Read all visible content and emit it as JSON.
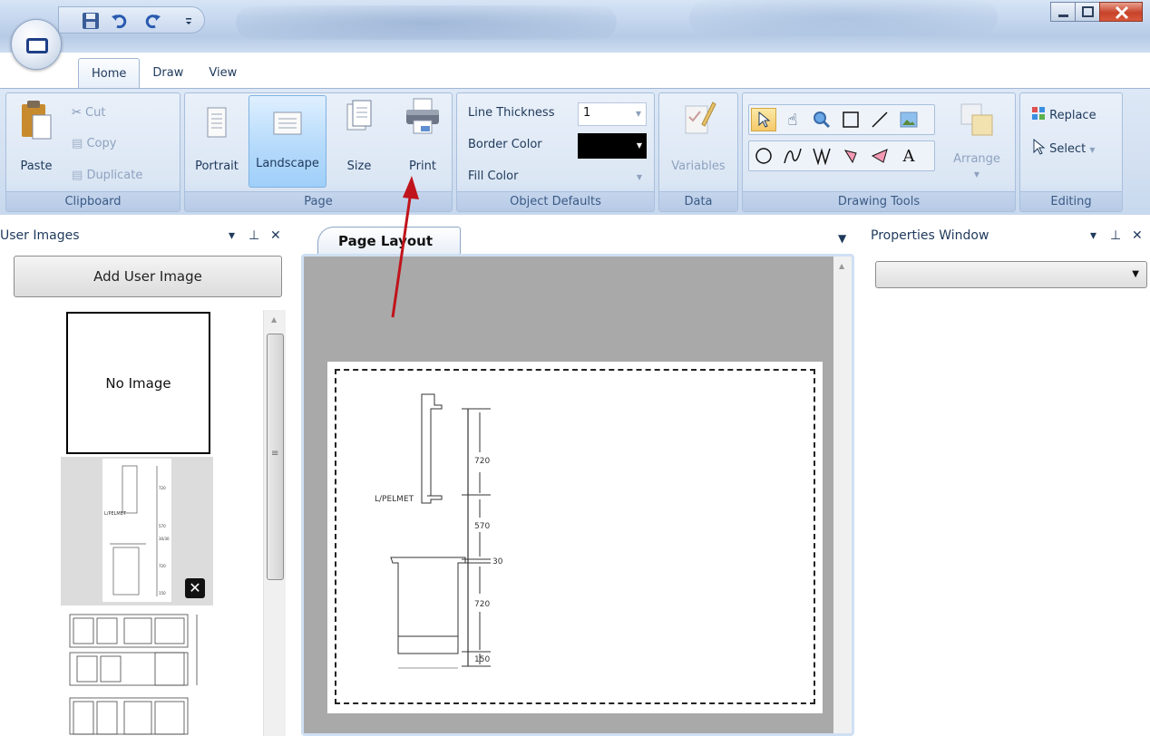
{
  "tabs": [
    {
      "label": "Home",
      "active": true
    },
    {
      "label": "Draw",
      "active": false
    },
    {
      "label": "View",
      "active": false
    }
  ],
  "quick_access": [
    "save-icon",
    "undo-icon",
    "redo-icon",
    "customize-dropdown-icon"
  ],
  "window_controls": [
    "minimize",
    "maximize",
    "close"
  ],
  "ribbon": {
    "clipboard": {
      "label": "Clipboard",
      "paste": "Paste",
      "cut": "Cut",
      "copy": "Copy",
      "duplicate": "Duplicate"
    },
    "page": {
      "label": "Page",
      "portrait": "Portrait",
      "landscape": "Landscape",
      "size": "Size",
      "print": "Print",
      "selected_orientation": "Landscape"
    },
    "object_defaults": {
      "label": "Object Defaults",
      "line_thickness_label": "Line Thickness",
      "line_thickness_value": "1",
      "border_color_label": "Border Color",
      "border_color_value": "#000000",
      "fill_color_label": "Fill Color"
    },
    "data": {
      "label": "Data",
      "variables": "Variables"
    },
    "drawing_tools": {
      "label": "Drawing Tools",
      "arrange": "Arrange",
      "row1_tools": [
        "pointer-tool",
        "pan-tool",
        "zoom-tool",
        "rectangle-tool",
        "line-tool",
        "image-tool"
      ],
      "row2_tools": [
        "ellipse-tool",
        "curve-tool",
        "polyline-tool",
        "shape-tool",
        "polygon-tool",
        "text-tool"
      ],
      "selected_tool": "pointer-tool"
    },
    "editing": {
      "label": "Editing",
      "replace": "Replace",
      "select": "Select"
    }
  },
  "left_panel": {
    "title": "User Images",
    "add_button": "Add User Image",
    "no_image_label": "No Image"
  },
  "center_panel": {
    "tab_label": "Page Layout"
  },
  "right_panel": {
    "title": "Properties Window",
    "select_value": ""
  },
  "drawing": {
    "label": "L/PELMET",
    "dimensions": [
      "720",
      "570",
      "30",
      "720",
      "150"
    ]
  },
  "thumbnail": {
    "label": "L/PELMET",
    "dimensions": [
      "720",
      "570",
      "30/30",
      "720",
      "150"
    ]
  },
  "colors": {
    "accent_arrow": "#c0141c",
    "selected_tool_bg": "#f5c96a",
    "active_button_bg": "#b9dcfb",
    "page_background": "#a9a9a9"
  }
}
